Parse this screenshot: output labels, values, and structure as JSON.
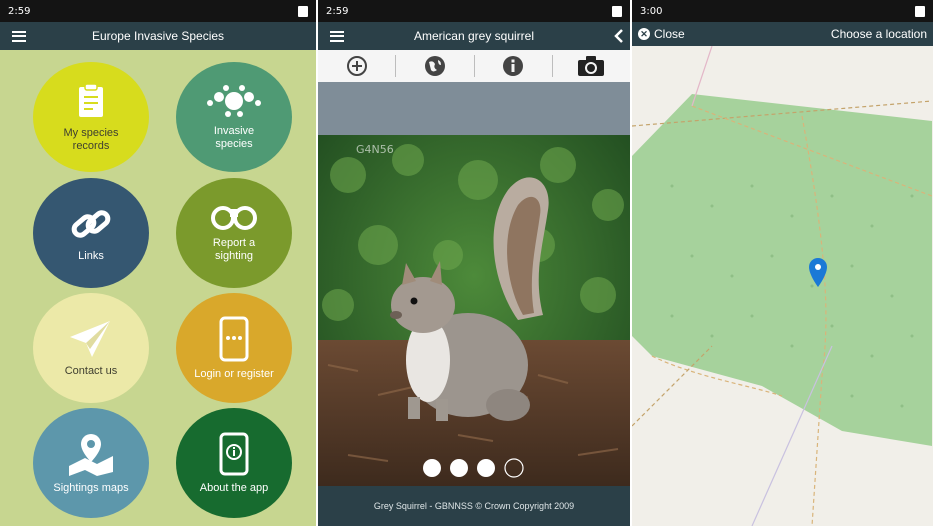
{
  "panel1": {
    "status_time": "2:59",
    "title": "Europe Invasive Species",
    "tiles": [
      {
        "label": "My species records",
        "color": "#d7dc1d"
      },
      {
        "label": "Invasive species",
        "color": "#4f9a74"
      },
      {
        "label": "Links",
        "color": "#355771"
      },
      {
        "label": "Report a sighting",
        "color": "#7b9a2c"
      },
      {
        "label": "Contact us",
        "color": "#ece9a8"
      },
      {
        "label": "Login or register",
        "color": "#d9a82b"
      },
      {
        "label": "Sightings maps",
        "color": "#5d97ab"
      },
      {
        "label": "About the app",
        "color": "#176b2f"
      }
    ]
  },
  "panel2": {
    "status_time": "2:59",
    "title": "American grey squirrel",
    "watermark": "G4N56",
    "caption": "Grey Squirrel - GBNNSS © Crown Copyright 2009",
    "toolbar_icons": [
      "plus-circle-icon",
      "globe-icon",
      "info-icon",
      "camera-icon"
    ]
  },
  "panel3": {
    "status_time": "3:00",
    "title": "Choose a location",
    "close_label": "Close",
    "map_fill": "#a6d29c",
    "pin_color": "#1a79d6"
  }
}
